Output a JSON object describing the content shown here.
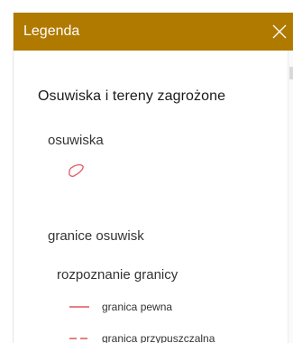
{
  "header": {
    "title": "Legenda",
    "close_icon": "close-icon"
  },
  "legend": {
    "layer_title": "Osuwiska i tereny zagrożone",
    "groups": [
      {
        "label": "osuwiska",
        "symbol": "polygon-outline-icon",
        "color": "#e25a62"
      },
      {
        "label": "granice osuwisk",
        "sublabel": "rozpoznanie granicy",
        "items": [
          {
            "label": "granica pewna",
            "line_style": "solid",
            "color": "#e88080"
          },
          {
            "label": "granica przypuszczalna",
            "line_style": "dashed",
            "color": "#e88080"
          }
        ]
      }
    ]
  },
  "colors": {
    "header_bg": "#b07a00",
    "header_text": "#ffffff"
  }
}
